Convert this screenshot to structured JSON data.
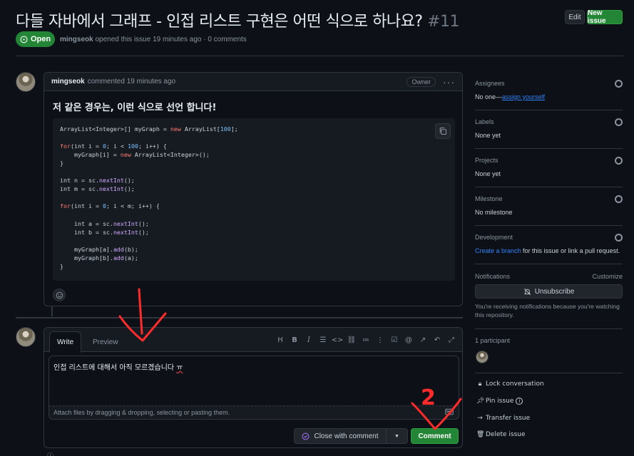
{
  "issue": {
    "title": "다들 자바에서 그래프 - 인접 리스트 구현은 어떤 식으로 하나요?",
    "number": "#11",
    "edit_label": "Edit",
    "new_issue_label": "New issue",
    "status": "Open",
    "author": "mingseok",
    "opened_text": "opened this issue 19 minutes ago · 0 comments"
  },
  "comment": {
    "author": "mingseok",
    "time": "commented 19 minutes ago",
    "role": "Owner",
    "heading": "저 같은 경우는, 이런 식으로 선언 합니다!",
    "code": [
      [
        {
          "t": "ArrayList<Integer>[] myGraph = "
        },
        {
          "t": "new",
          "c": "kw"
        },
        {
          "t": " ArrayList["
        },
        {
          "t": "100",
          "c": "nb"
        },
        {
          "t": "];"
        }
      ],
      [],
      [
        {
          "t": "for",
          "c": "kw"
        },
        {
          "t": "(int i = "
        },
        {
          "t": "0",
          "c": "nb"
        },
        {
          "t": "; i < "
        },
        {
          "t": "100",
          "c": "nb"
        },
        {
          "t": "; i++) {"
        }
      ],
      [
        {
          "t": "    myGraph[i] = "
        },
        {
          "t": "new",
          "c": "kw"
        },
        {
          "t": " ArrayList<Integer>();"
        }
      ],
      [
        {
          "t": "}"
        }
      ],
      [],
      [
        {
          "t": "int n = sc."
        },
        {
          "t": "nextInt",
          "c": "fn"
        },
        {
          "t": "();"
        }
      ],
      [
        {
          "t": "int m = sc."
        },
        {
          "t": "nextInt",
          "c": "fn"
        },
        {
          "t": "();"
        }
      ],
      [],
      [
        {
          "t": "for",
          "c": "kw"
        },
        {
          "t": "(int i = "
        },
        {
          "t": "0",
          "c": "nb"
        },
        {
          "t": "; i < m; i++) {"
        }
      ],
      [],
      [
        {
          "t": "    int a = sc."
        },
        {
          "t": "nextInt",
          "c": "fn"
        },
        {
          "t": "();"
        }
      ],
      [
        {
          "t": "    int b = sc."
        },
        {
          "t": "nextInt",
          "c": "fn"
        },
        {
          "t": "();"
        }
      ],
      [],
      [
        {
          "t": "    myGraph[a]."
        },
        {
          "t": "add",
          "c": "fn"
        },
        {
          "t": "(b);"
        }
      ],
      [
        {
          "t": "    myGraph[b]."
        },
        {
          "t": "add",
          "c": "fn"
        },
        {
          "t": "(a);"
        }
      ],
      [
        {
          "t": "}"
        }
      ]
    ]
  },
  "editor": {
    "tab_write": "Write",
    "tab_preview": "Preview",
    "text_main": "인접 리스트에 대해서 아직 모르겠습니다 ",
    "text_misspelled": "ㅠ",
    "attach_hint": "Attach files by dragging & dropping, selecting or pasting them.",
    "close_label": "Close with comment",
    "comment_label": "Comment"
  },
  "sidebar": {
    "assignees_title": "Assignees",
    "assignees_none": "No one—",
    "assign_yourself": "assign yourself",
    "labels_title": "Labels",
    "labels_value": "None yet",
    "projects_title": "Projects",
    "projects_value": "None yet",
    "milestone_title": "Milestone",
    "milestone_value": "No milestone",
    "development_title": "Development",
    "create_branch": "Create a branch",
    "development_rest": " for this issue or link a pull request.",
    "notifications_title": "Notifications",
    "customize": "Customize",
    "unsubscribe": "Unsubscribe",
    "notify_text": "You're receiving notifications because you're watching this repository.",
    "participants": "1 participant",
    "lock": "Lock conversation",
    "pin": "Pin issue",
    "transfer": "Transfer issue",
    "delete": "Delete issue"
  },
  "annotations": {
    "number_2": "2"
  },
  "colors": {
    "bg": "#0d1117",
    "green": "#238636",
    "link": "#2f81f7",
    "annotation": "#ff2a2a"
  }
}
